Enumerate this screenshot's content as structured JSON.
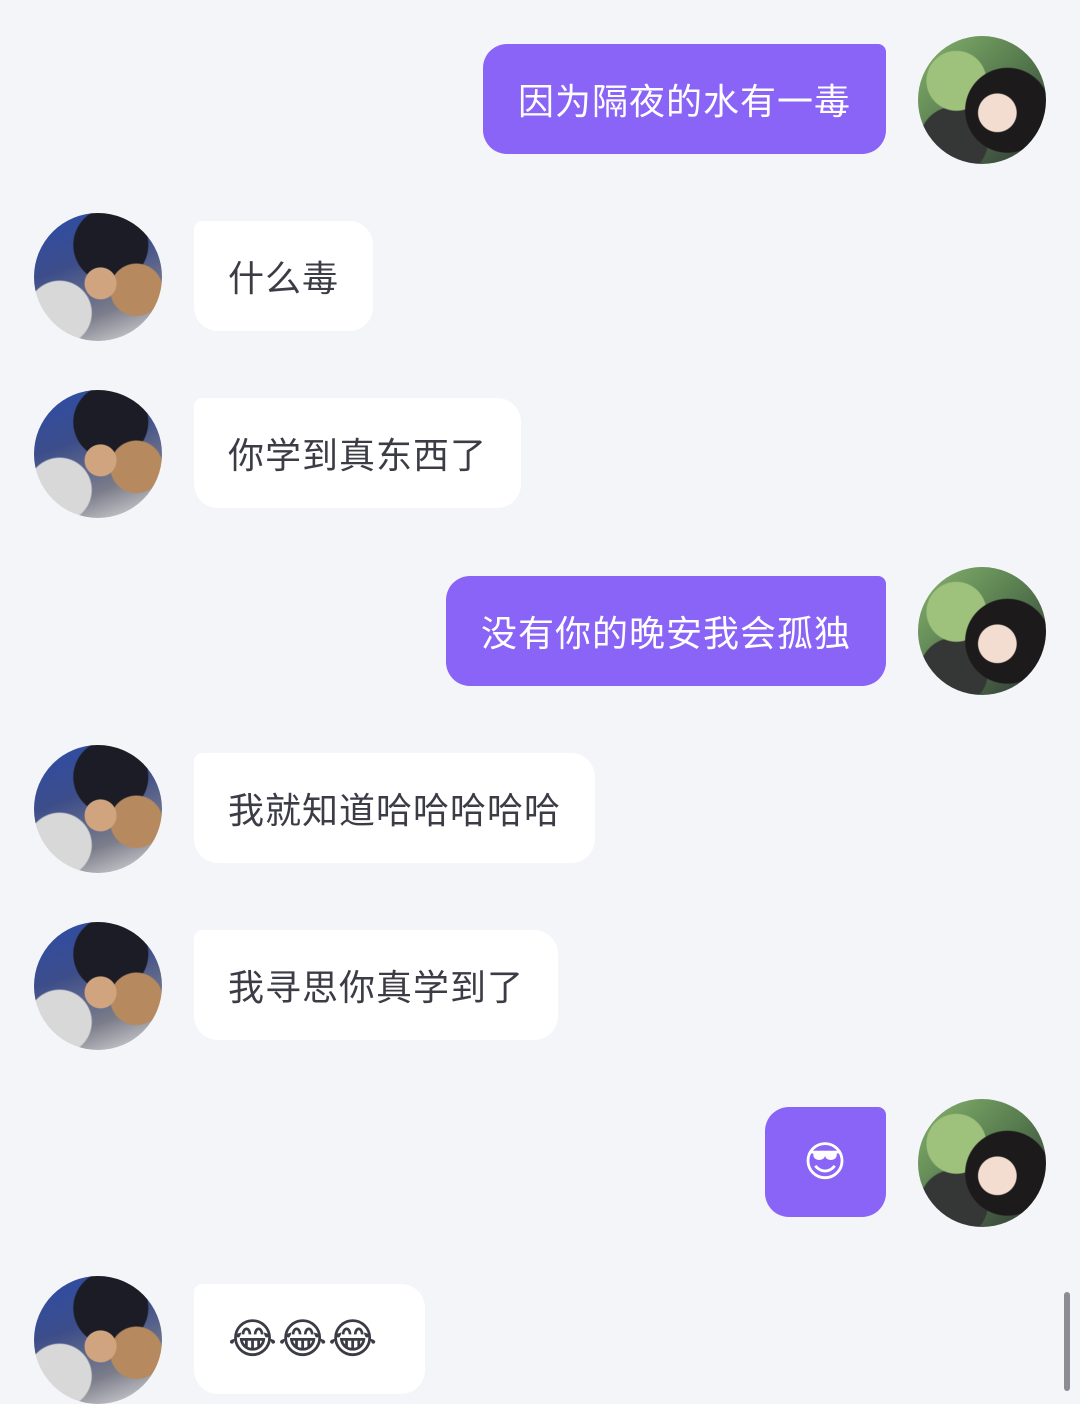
{
  "messages": [
    {
      "side": "out",
      "text": "因为隔夜的水有一毒"
    },
    {
      "side": "in",
      "text": "什么毒"
    },
    {
      "side": "in",
      "text": "你学到真东西了"
    },
    {
      "side": "out",
      "text": "没有你的晚安我会孤独"
    },
    {
      "side": "in",
      "text": "我就知道哈哈哈哈哈"
    },
    {
      "side": "in",
      "text": "我寻思你真学到了"
    },
    {
      "side": "out",
      "text": "😎"
    },
    {
      "side": "in",
      "text": "😂😂😂"
    }
  ],
  "colors": {
    "background": "#f4f5f9",
    "outgoing_bubble": "#8a63f7",
    "incoming_bubble": "#ffffff",
    "incoming_text": "#3c3c46"
  }
}
